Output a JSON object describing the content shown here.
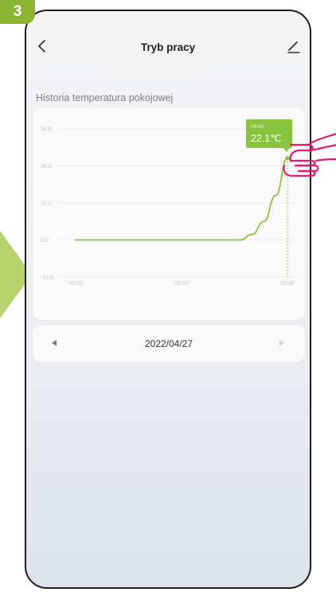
{
  "step_badge": "3",
  "header": {
    "title": "Tryb pracy",
    "back_icon": "chevron-left-icon",
    "edit_icon": "pencil-icon"
  },
  "section_title": "Historia temperatura pokojowej",
  "chart_data": {
    "type": "line",
    "x_tick_labels": [
      "00:00",
      "05:00",
      "09:00"
    ],
    "y_tick_labels": [
      "30.0",
      "20.0",
      "10.0",
      "0.0",
      "-10.0"
    ],
    "ylim": [
      -10,
      30
    ],
    "x": [
      0,
      7,
      7.5,
      8,
      8.5,
      9
    ],
    "values": [
      0,
      0,
      1.5,
      5,
      12,
      22.1
    ],
    "grid": true,
    "line_color": "#8ac43f",
    "tooltip": {
      "time": "09:00",
      "value": "22.1℃"
    }
  },
  "date_picker": {
    "date": "2022/04/27",
    "prev_icon": "triangle-left-icon",
    "next_icon": "triangle-right-icon"
  },
  "colors": {
    "accent_green": "#8ac43f",
    "badge_green": "#8ab634",
    "pointer_pink": "#e8176f"
  }
}
